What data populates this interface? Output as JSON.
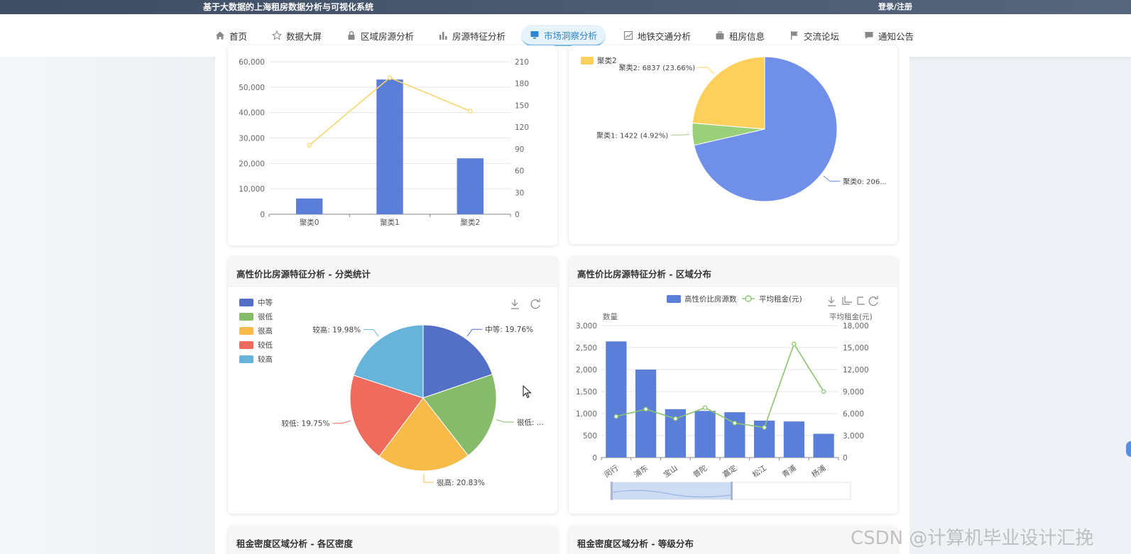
{
  "header": {
    "title": "基于大数据的上海租房数据分析与可视化系统",
    "login": "登录/注册"
  },
  "nav": {
    "items": [
      {
        "label": "首页",
        "icon": "home-icon"
      },
      {
        "label": "数据大屏",
        "icon": "star-icon"
      },
      {
        "label": "区域房源分析",
        "icon": "lock-icon"
      },
      {
        "label": "房源特征分析",
        "icon": "bar-chart-icon"
      },
      {
        "label": "市场洞察分析",
        "icon": "monitor-icon"
      },
      {
        "label": "地铁交通分析",
        "icon": "trend-icon"
      },
      {
        "label": "租房信息",
        "icon": "briefcase-icon"
      },
      {
        "label": "交流论坛",
        "icon": "flag-icon"
      },
      {
        "label": "通知公告",
        "icon": "message-icon"
      }
    ],
    "active_index": 4
  },
  "cards": {
    "cluster_bar": {
      "title": ""
    },
    "cluster_pie": {
      "title": ""
    },
    "category_pie": {
      "title": "高性价比房源特征分析 - 分类统计"
    },
    "district": {
      "title": "高性价比房源特征分析 - 区域分布"
    },
    "density_district": {
      "title": "租金密度区域分析 - 各区密度"
    },
    "density_level": {
      "title": "租金密度区域分析 - 等级分布"
    }
  },
  "chart_data": [
    {
      "type": "bar",
      "categories": [
        "聚类0",
        "聚类1",
        "聚类2"
      ],
      "series": [
        {
          "type": "bar",
          "values": [
            6200,
            53000,
            22000
          ],
          "axis": "left",
          "color": "#5b7fd8"
        },
        {
          "type": "line",
          "values": [
            95,
            188,
            142
          ],
          "axis": "right",
          "color": "#f8d66b"
        }
      ],
      "y_left": {
        "min": 0,
        "max": 60000,
        "ticks": [
          "0",
          "10,000",
          "20,000",
          "30,000",
          "40,000",
          "50,000",
          "60,000"
        ]
      },
      "y_right": {
        "min": 0,
        "max": 210,
        "ticks": [
          "0",
          "30",
          "60",
          "90",
          "120",
          "150",
          "180",
          "210"
        ]
      }
    },
    {
      "type": "pie",
      "legend_visible": [
        "聚类2"
      ],
      "slices": [
        {
          "label": "聚类0: 206...",
          "value": 71.42,
          "color": "#6f8fe8"
        },
        {
          "label": "聚类1: 1422 (4.92%)",
          "value": 4.92,
          "color": "#9bd07a"
        },
        {
          "label": "聚类2: 6837 (23.66%)",
          "value": 23.66,
          "color": "#fdd05c"
        }
      ]
    },
    {
      "type": "pie",
      "legend": [
        "中等",
        "很低",
        "很高",
        "较低",
        "较高"
      ],
      "slices": [
        {
          "name": "中等",
          "label": "中等: 19.76%",
          "value": 19.76,
          "color": "#5470c6"
        },
        {
          "name": "很低",
          "label": "很低: ...",
          "value": 19.7,
          "color": "#86bb69"
        },
        {
          "name": "很高",
          "label": "很高: 20.83%",
          "value": 20.83,
          "color": "#f6bb48"
        },
        {
          "name": "较低",
          "label": "较低: 19.75%",
          "value": 19.75,
          "color": "#ef6b5e"
        },
        {
          "name": "较高",
          "label": "较高: 19.98%",
          "value": 19.98,
          "color": "#67b4db"
        }
      ]
    },
    {
      "type": "bar",
      "legend": [
        "高性价比房源数",
        "平均租金(元)"
      ],
      "ylabel_left": "数量",
      "ylabel_right": "平均租金(元)",
      "categories": [
        "闵行",
        "浦东",
        "宝山",
        "普陀",
        "嘉定",
        "松江",
        "青浦",
        "杨浦"
      ],
      "series": [
        {
          "name": "高性价比房源数",
          "type": "bar",
          "values": [
            2640,
            2000,
            1100,
            1060,
            1030,
            840,
            820,
            540
          ],
          "axis": "left",
          "color": "#5b7fd8"
        },
        {
          "name": "平均租金(元)",
          "type": "line",
          "values": [
            5600,
            6600,
            5300,
            6800,
            4700,
            4100,
            15500,
            9000
          ],
          "axis": "right",
          "color": "#8ac56d"
        }
      ],
      "y_left": {
        "min": 0,
        "max": 3000,
        "ticks": [
          "0",
          "500",
          "1,000",
          "1,500",
          "2,000",
          "2,500",
          "3,000"
        ]
      },
      "y_right": {
        "min": 0,
        "max": 18000,
        "ticks": [
          "0",
          "3,000",
          "6,000",
          "9,000",
          "12,000",
          "15,000",
          "18,000"
        ]
      }
    }
  ],
  "watermark": "CSDN @计算机毕业设计汇挽"
}
